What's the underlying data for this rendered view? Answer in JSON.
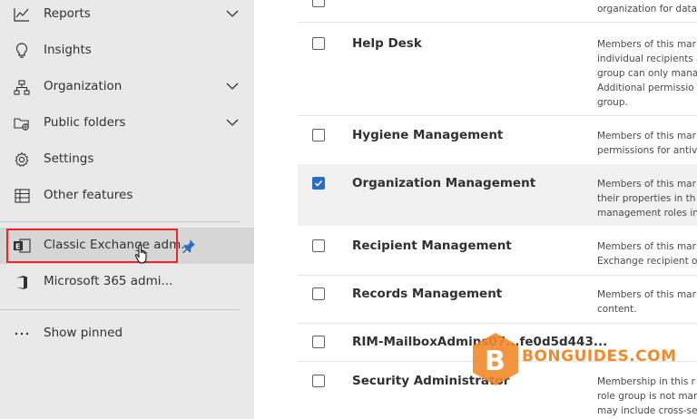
{
  "sidebar": {
    "items": [
      {
        "label": "Reports",
        "icon": "chart-line-icon",
        "has_chevron": true
      },
      {
        "label": "Insights",
        "icon": "lightbulb-icon",
        "has_chevron": false
      },
      {
        "label": "Organization",
        "icon": "org-chart-icon",
        "has_chevron": true
      },
      {
        "label": "Public folders",
        "icon": "folder-globe-icon",
        "has_chevron": true
      },
      {
        "label": "Settings",
        "icon": "gear-icon",
        "has_chevron": false
      },
      {
        "label": "Other features",
        "icon": "table-icon",
        "has_chevron": false
      }
    ],
    "pinned": [
      {
        "label": "Classic Exchange adm...",
        "icon": "exchange-icon"
      },
      {
        "label": "Microsoft 365 admi...",
        "icon": "office-icon"
      }
    ],
    "show_pinned_label": "Show pinned"
  },
  "roles": [
    {
      "name": "",
      "desc": [
        "organization for data"
      ],
      "checked": false
    },
    {
      "name": "Help Desk",
      "desc": [
        "Members of this mar",
        "individual recipients a",
        "group can only mana",
        "Additional permissio",
        "group."
      ],
      "checked": false
    },
    {
      "name": "Hygiene Management",
      "desc": [
        "Members of this mar",
        "permissions for antiv"
      ],
      "checked": false
    },
    {
      "name": "Organization Management",
      "desc": [
        "Members of this mar",
        "their properties in th",
        "management roles in"
      ],
      "checked": true
    },
    {
      "name": "Recipient Management",
      "desc": [
        "Members of this mar",
        "Exchange recipient o"
      ],
      "checked": false
    },
    {
      "name": "Records Management",
      "desc": [
        "Members of this mar",
        "content."
      ],
      "checked": false
    },
    {
      "name": "RIM-MailboxAdmins07...fe0d5d443...",
      "desc": [],
      "checked": false
    },
    {
      "name": "Security Administrator",
      "desc": [
        "Membership in this r",
        "role group is not mar",
        "may include cross-se"
      ],
      "checked": false
    }
  ],
  "watermark": {
    "text": "BONGUIDES.COM",
    "letter": "B"
  },
  "colors": {
    "accent": "#2b6cc4",
    "highlight": "#e8262b",
    "watermark": "#f08a2b"
  }
}
